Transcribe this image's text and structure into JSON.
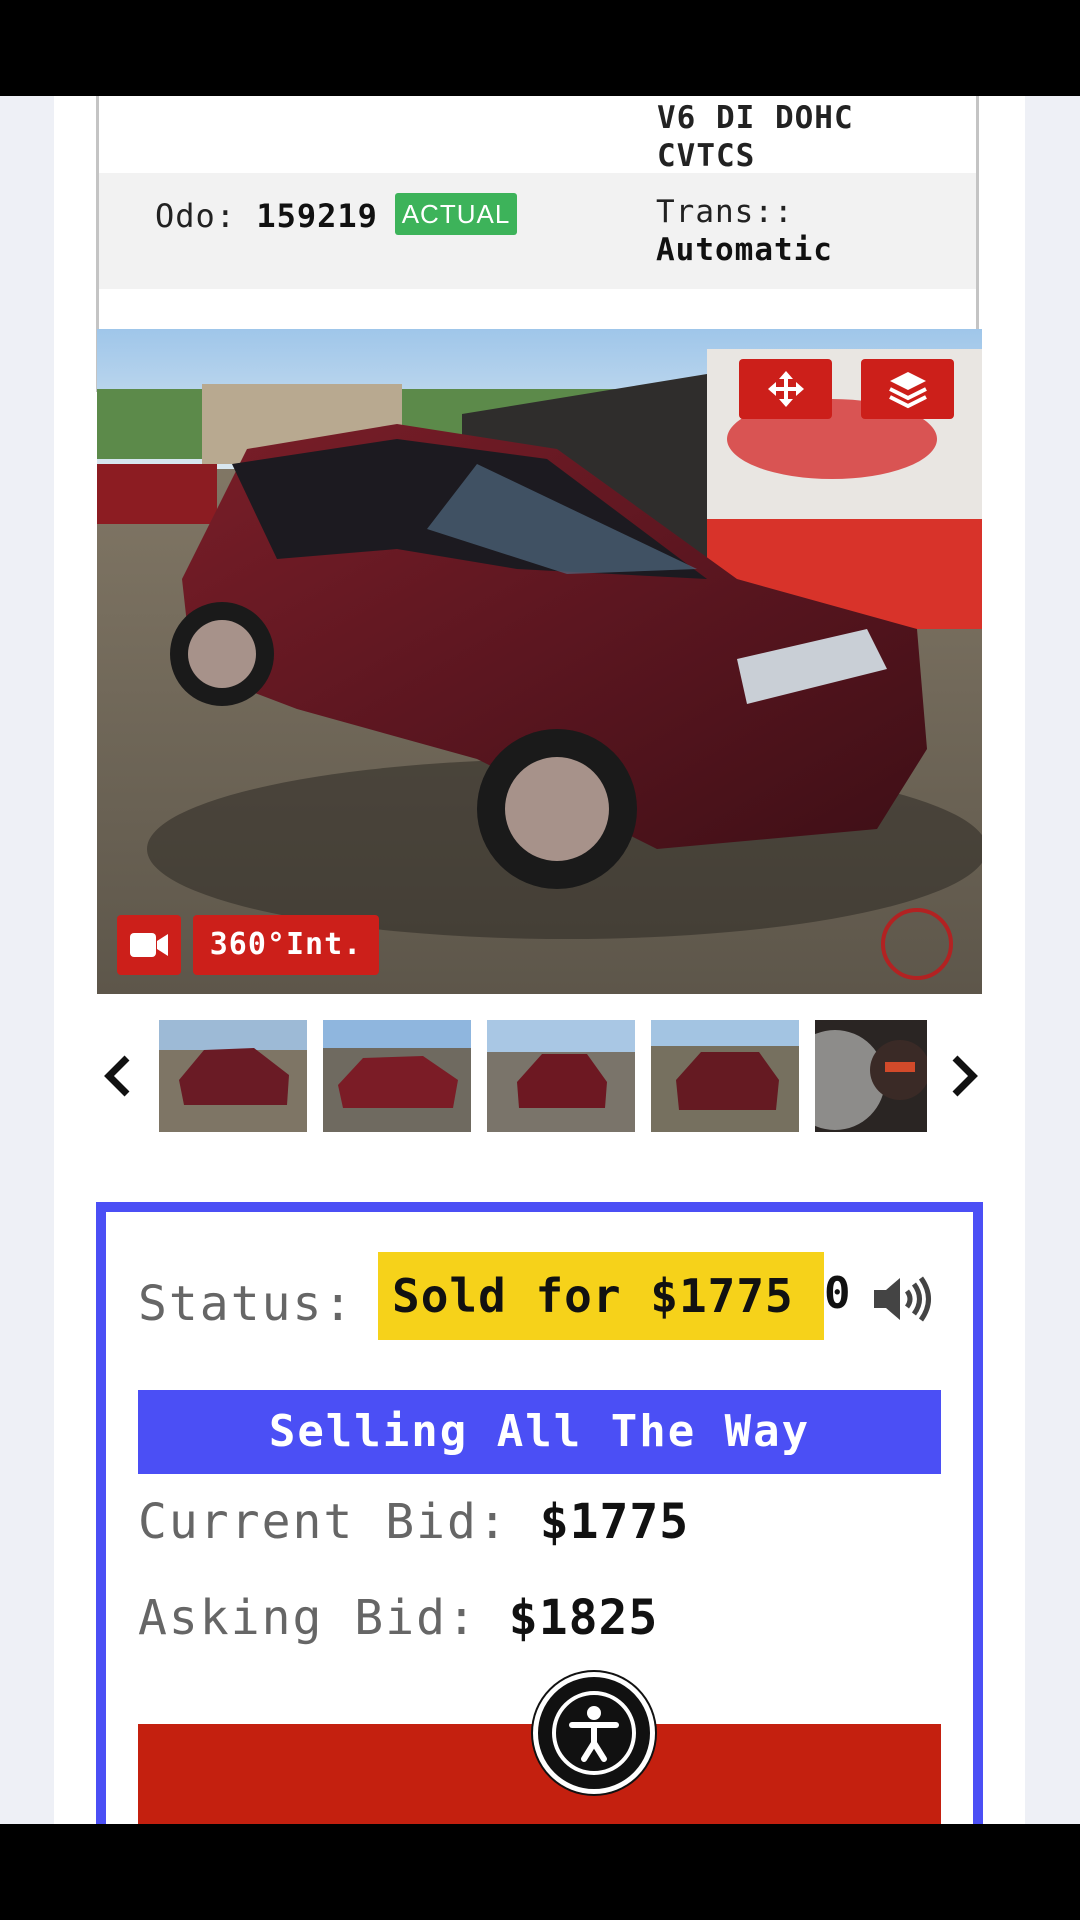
{
  "spec": {
    "engine_text": "V6 DI DOHC CVTCS",
    "engine_line1": "V6 DI DOHC",
    "engine_line2": "CVTCS",
    "odo_label": "Odo:",
    "odo_value": "159219",
    "odo_badge": "ACTUAL",
    "trans_label": "Trans::",
    "trans_value": "Automatic"
  },
  "gallery": {
    "main_photo": "vehicle-photo",
    "move_icon": "move-arrows-icon",
    "layers_icon": "layers-icon",
    "video_icon": "video-camera-icon",
    "interior_360_label": "360°Int.",
    "prev_icon": "chevron-left-icon",
    "next_icon": "chevron-right-icon",
    "thumbnail_count_visible": 5
  },
  "auction": {
    "status_label": "Status:",
    "status_value": "Sold for $1775",
    "status_overflow": "0",
    "speaker_icon": "speaker-icon",
    "selling_banner": "Selling All The Way",
    "current_bid_label": "Current Bid:",
    "current_bid_value": "$1775",
    "asking_bid_label": "Asking Bid:",
    "asking_bid_value": "$1825"
  },
  "colors": {
    "accent_blue": "#4b4ff5",
    "button_red": "#cc1f1a",
    "sold_yellow": "#f6d21a",
    "badge_green": "#3db35a"
  },
  "accessibility_icon": "accessibility-icon"
}
